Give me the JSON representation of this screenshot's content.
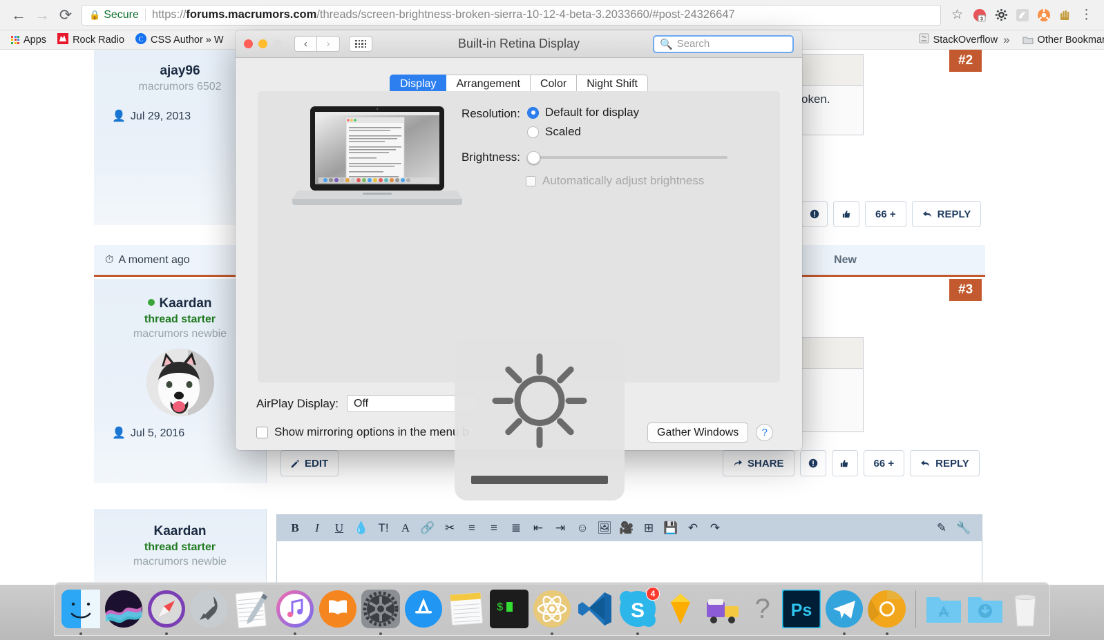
{
  "browser": {
    "security_label": "Secure",
    "url": {
      "scheme": "https://",
      "host": "forums.macrumors.com",
      "path": "/threads/screen-brightness-broken-sierra-10-12-4-beta-3.2033660/#post-24326647"
    },
    "icons": {
      "back": "back-arrow-icon",
      "forward": "forward-arrow-icon",
      "reload": "reload-icon",
      "lock": "lock-icon",
      "star": "bookmark-star-icon",
      "menu": "chrome-menu-icon"
    },
    "extensions": [
      {
        "name": "adblock-extension-icon",
        "badge": "3"
      },
      {
        "name": "gear-extension-icon",
        "badge": ""
      },
      {
        "name": "comet-extension-icon",
        "badge": ""
      },
      {
        "name": "orange-circle-extension-icon",
        "badge": ""
      },
      {
        "name": "hand-extension-icon",
        "badge": ""
      }
    ],
    "bookmarks": [
      {
        "label": "Apps",
        "icon": "apps-grid-icon"
      },
      {
        "label": "Rock Radio",
        "icon": "rock-radio-icon"
      },
      {
        "label": "CSS Author » W",
        "icon": "css-author-icon"
      },
      {
        "label": "StackOverflow",
        "icon": "stackoverflow-icon"
      }
    ],
    "overflow_chevron": "»",
    "other_bookmarks": "Other Bookmarks"
  },
  "forum": {
    "post2": {
      "username": "ajay96",
      "usertitle": "macrumors 6502",
      "joined": "Jul 29, 2013",
      "number": "#2",
      "quote_text": "adjustment is broken.",
      "buttons": [
        "!",
        "👍",
        "66 +",
        "REPLY"
      ],
      "reply_label": "REPLY",
      "quote_label": "66 +"
    },
    "post3": {
      "timestamp": "A moment ago",
      "new_label": "New",
      "username": "Kaardan",
      "thread_starter": "thread starter",
      "usertitle": "macrumors newbie",
      "joined": "Jul 5, 2016",
      "number": "#3",
      "edit_label": "EDIT",
      "share_label": "SHARE",
      "reply_label": "REPLY",
      "quote_label": "66 +"
    },
    "post4": {
      "username": "Kaardan",
      "thread_starter": "thread starter",
      "usertitle": "macrumors newbie"
    },
    "editor_toolbar": [
      "bold-icon",
      "italic-icon",
      "underline-icon",
      "text-color-icon",
      "font-size-icon",
      "font-family-icon",
      "link-icon",
      "unlink-icon",
      "align-icon",
      "bullet-list-icon",
      "numbered-list-icon",
      "outdent-icon",
      "indent-icon",
      "smiley-icon",
      "image-icon",
      "media-icon",
      "table-icon",
      "save-draft-icon",
      "undo-icon",
      "redo-icon"
    ],
    "editor_toolbar_right": [
      "eraser-icon",
      "wrench-icon"
    ],
    "accent_color": "#c3592e"
  },
  "display_prefs": {
    "window_title": "Built-in Retina Display",
    "search_placeholder": "Search",
    "tabs": [
      {
        "label": "Display",
        "selected": true
      },
      {
        "label": "Arrangement",
        "selected": false
      },
      {
        "label": "Color",
        "selected": false
      },
      {
        "label": "Night Shift",
        "selected": false
      }
    ],
    "resolution_label": "Resolution:",
    "resolution_options": [
      {
        "label": "Default for display",
        "selected": true
      },
      {
        "label": "Scaled",
        "selected": false
      }
    ],
    "brightness_label": "Brightness:",
    "brightness_value": 0,
    "auto_brightness_label": "Automatically adjust brightness",
    "auto_brightness_checked": false,
    "auto_brightness_disabled": true,
    "airplay_label": "AirPlay Display:",
    "airplay_value": "Off",
    "mirroring_label": "Show mirroring options in the menu b",
    "mirroring_checked": false,
    "gather_windows_label": "Gather Windows",
    "help_label": "?",
    "accent_color": "#2d7ff0"
  },
  "brightness_hud": {
    "icon": "brightness-sun-icon",
    "level_percent": 100
  },
  "dock": {
    "items": [
      {
        "name": "finder",
        "running": true
      },
      {
        "name": "siri",
        "running": false
      },
      {
        "name": "safari",
        "running": true
      },
      {
        "name": "launchpad",
        "running": false
      },
      {
        "name": "notes",
        "running": false
      },
      {
        "name": "itunes",
        "running": true
      },
      {
        "name": "ibooks",
        "running": false
      },
      {
        "name": "system-preferences",
        "running": true
      },
      {
        "name": "app-store",
        "running": false
      },
      {
        "name": "stickies",
        "running": false
      },
      {
        "name": "terminal",
        "running": false
      },
      {
        "name": "atom",
        "running": true
      },
      {
        "name": "visual-studio-code",
        "running": false
      },
      {
        "name": "skype",
        "running": true,
        "badge": "4"
      },
      {
        "name": "sketch",
        "running": false
      },
      {
        "name": "transmit",
        "running": false
      },
      {
        "name": "unknown-app",
        "running": false
      },
      {
        "name": "photoshop",
        "running": false
      },
      {
        "name": "telegram",
        "running": true
      },
      {
        "name": "chrome-canary",
        "running": true
      }
    ],
    "stacks": [
      {
        "name": "applications-folder"
      },
      {
        "name": "downloads-folder"
      },
      {
        "name": "trash"
      }
    ]
  }
}
